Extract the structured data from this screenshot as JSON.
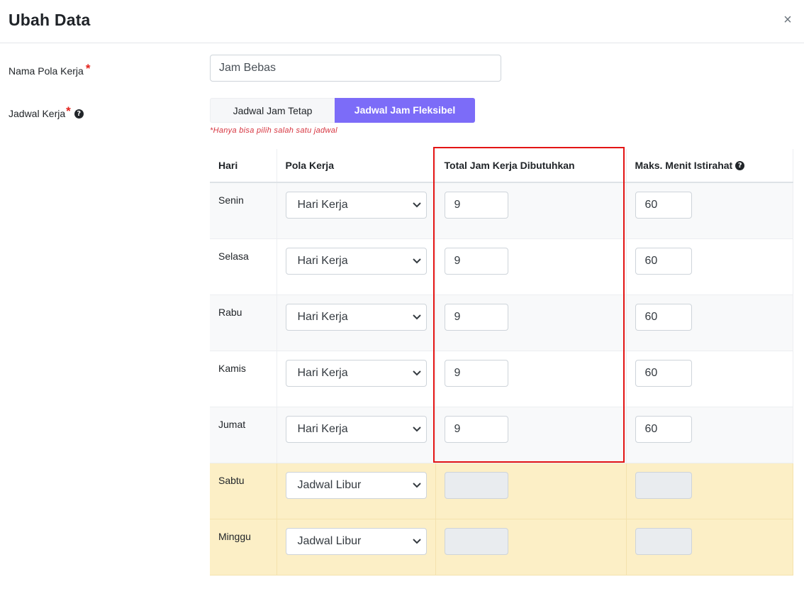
{
  "modal": {
    "title": "Ubah Data",
    "close_glyph": "×"
  },
  "form": {
    "name_label": "Nama Pola Kerja",
    "name_value": "Jam Bebas",
    "schedule_label": "Jadwal Kerja",
    "required_mark": "*",
    "help_glyph": "?",
    "toggle_fixed": "Jadwal Jam Tetap",
    "toggle_flexible": "Jadwal Jam Fleksibel",
    "hint": "*Hanya bisa pilih salah satu jadwal"
  },
  "table": {
    "headers": {
      "day": "Hari",
      "pattern": "Pola Kerja",
      "total_hours": "Total Jam Kerja Dibutuhkan",
      "max_break": "Maks. Menit Istirahat"
    },
    "rows": [
      {
        "day": "Senin",
        "pattern": "Hari Kerja",
        "hours": "9",
        "break": "60"
      },
      {
        "day": "Selasa",
        "pattern": "Hari Kerja",
        "hours": "9",
        "break": "60"
      },
      {
        "day": "Rabu",
        "pattern": "Hari Kerja",
        "hours": "9",
        "break": "60"
      },
      {
        "day": "Kamis",
        "pattern": "Hari Kerja",
        "hours": "9",
        "break": "60"
      },
      {
        "day": "Jumat",
        "pattern": "Hari Kerja",
        "hours": "9",
        "break": "60"
      },
      {
        "day": "Sabtu",
        "pattern": "Jadwal Libur",
        "hours": "",
        "break": ""
      },
      {
        "day": "Minggu",
        "pattern": "Jadwal Libur",
        "hours": "",
        "break": ""
      }
    ]
  },
  "colors": {
    "accent": "#7c6cf8",
    "required": "#e3231c",
    "highlight_box": "#e31414",
    "holiday_row": "#fcefc6"
  }
}
